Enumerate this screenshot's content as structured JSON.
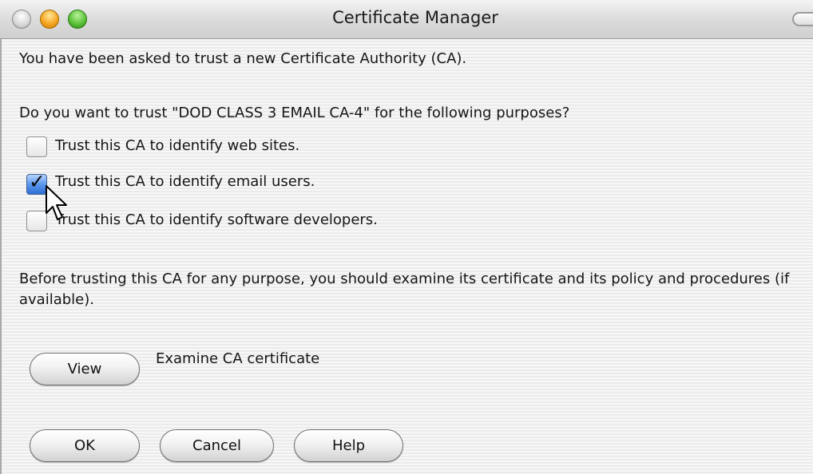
{
  "window": {
    "title": "Certificate Manager"
  },
  "dialog": {
    "intro": "You have been asked to trust a new Certificate Authority (CA).",
    "question": "Do you want to trust \"DOD CLASS 3 EMAIL CA-4\" for the following purposes?",
    "options": [
      {
        "label": "Trust this CA to identify web sites.",
        "checked": false
      },
      {
        "label": "Trust this CA to identify email users.",
        "checked": true
      },
      {
        "label": "Trust this CA to identify software developers.",
        "checked": false
      }
    ],
    "warning": "Before trusting this CA for any purpose, you should examine its certificate and its policy and procedures (if available).",
    "view_button": "View",
    "view_description": "Examine CA certificate",
    "buttons": {
      "ok": "OK",
      "cancel": "Cancel",
      "help": "Help"
    }
  },
  "icons": {
    "close": "close-button",
    "minimize": "minimize-button",
    "zoom": "zoom-button",
    "toolbar": "toolbar-toggle-button",
    "check": "checkmark-icon",
    "cursor": "mouse-pointer-icon"
  },
  "colors": {
    "close": "#d6d6d6",
    "minimize": "#f5a623",
    "zoom": "#5cc23a",
    "checked": "#5a97ec"
  }
}
